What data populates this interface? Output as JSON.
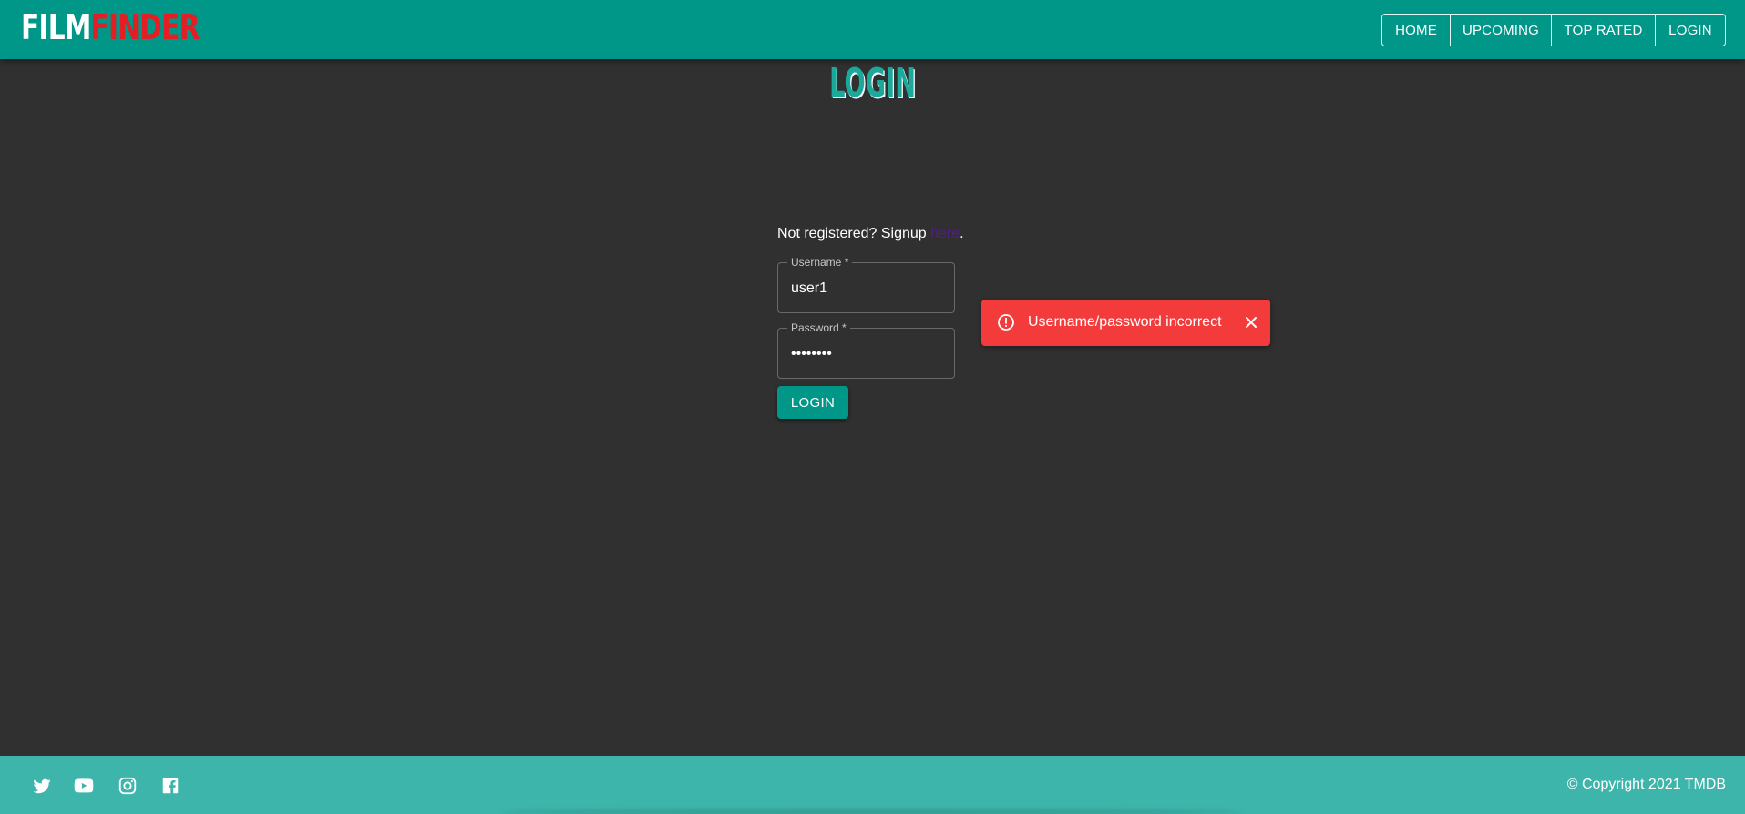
{
  "header": {
    "logo": {
      "part1": "FILM",
      "part2": "FINDER"
    },
    "nav": [
      {
        "label": "HOME"
      },
      {
        "label": "UPCOMING"
      },
      {
        "label": "TOP RATED"
      },
      {
        "label": "LOGIN"
      }
    ]
  },
  "page": {
    "title": "LOGIN"
  },
  "form": {
    "signup_prefix": "Not registered? Signup ",
    "signup_link": "here",
    "signup_suffix": ".",
    "username": {
      "label": "Username *",
      "value": "user1"
    },
    "password": {
      "label": "Password *",
      "value": "••••••••"
    },
    "login_button": "LOGIN"
  },
  "alert": {
    "message": "Username/password incorrect",
    "icon": "error-outline-icon",
    "color": "#f43b3b"
  },
  "footer": {
    "social": [
      "twitter-icon",
      "youtube-icon",
      "instagram-icon",
      "facebook-icon"
    ],
    "copyright": "© Copyright 2021 TMDB"
  },
  "colors": {
    "brand": "#009688",
    "logo_accent": "#e31e24",
    "background": "#303030",
    "footer": "#3db5aa"
  }
}
